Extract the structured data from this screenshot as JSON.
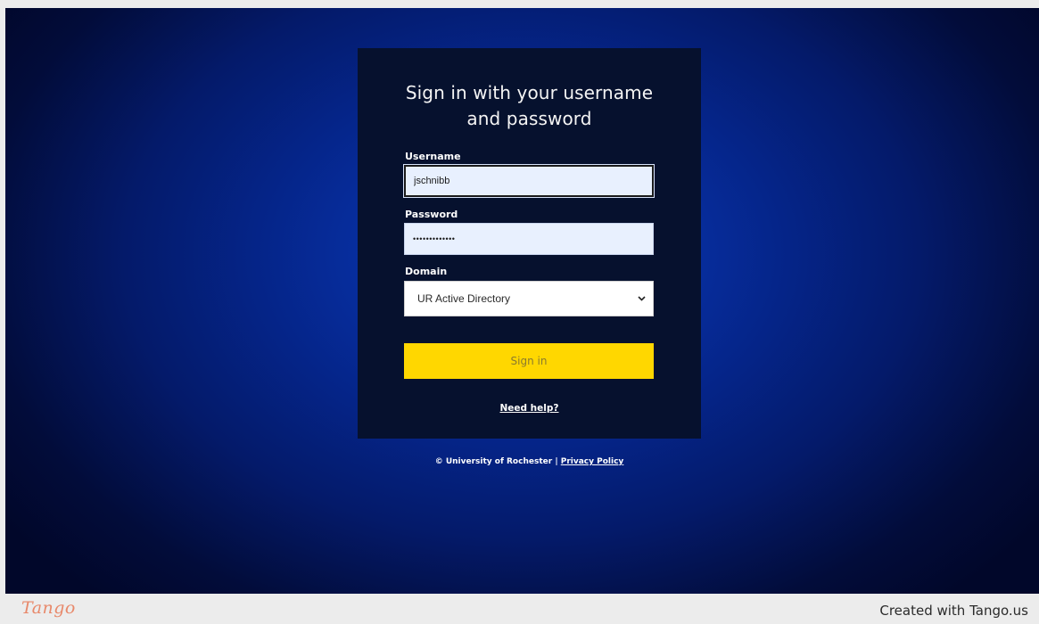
{
  "login": {
    "title_line1": "Sign in with your username",
    "title_line2": "and password",
    "username_label": "Username",
    "username_value": "jschnibb",
    "password_label": "Password",
    "password_mask": "•••••••••••••",
    "domain_label": "Domain",
    "domain_selected": "UR Active Directory",
    "signin_label": "Sign in",
    "help_link": "Need help?"
  },
  "footer": {
    "copyright": "© University of Rochester",
    "separator": "|",
    "privacy_link": "Privacy Policy"
  },
  "tango": {
    "logo_text": "Tango",
    "credit": "Created with Tango.us"
  },
  "colors": {
    "background_center": "#0b3fc6",
    "background_edge": "#01072a",
    "panel": "#06112e",
    "button": "#ffd700",
    "input_fill": "#e8f0fe",
    "brand_tango": "#e8886a"
  },
  "icons": {
    "select_arrow": "chevron-down-icon"
  }
}
